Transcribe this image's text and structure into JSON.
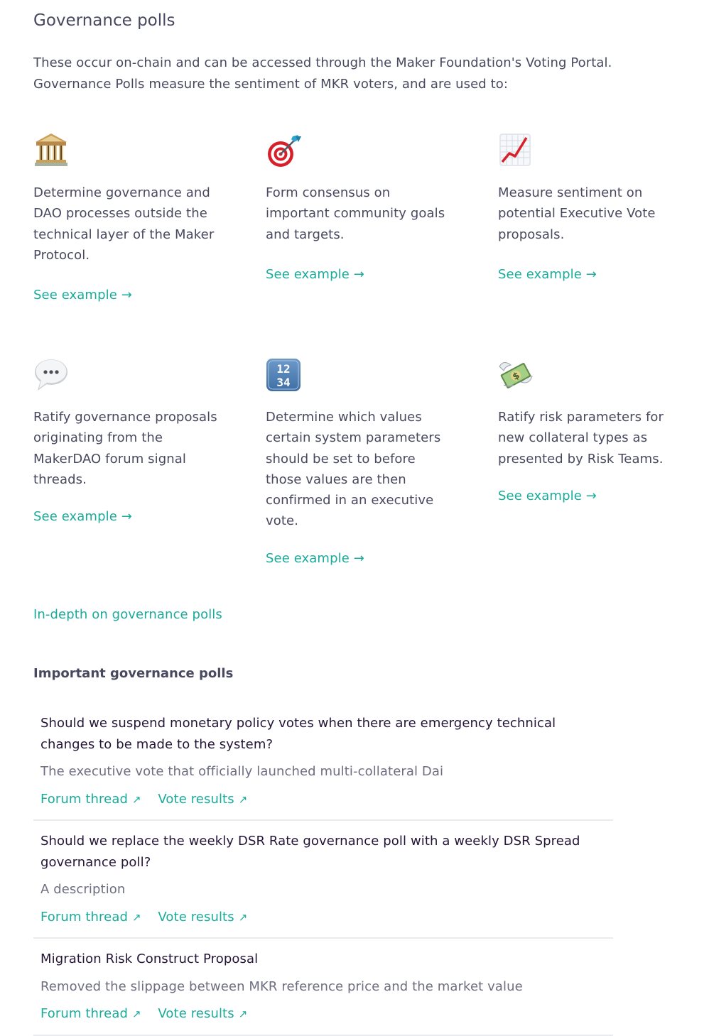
{
  "section": {
    "title": "Governance polls",
    "intro_line1": "These occur on-chain and can be accessed through the Maker Foundation's Voting Portal.",
    "intro_line2": "Governance Polls measure the sentiment of MKR voters, and are used to:"
  },
  "cards": [
    {
      "icon": "classical-building-icon",
      "text": "Determine governance and DAO processes outside the technical layer of the Maker Protocol.",
      "link": "See example",
      "link_arrow": "→"
    },
    {
      "icon": "direct-hit-target-icon",
      "text": "Form consensus on important community goals and targets.",
      "link": "See example",
      "link_arrow": "→"
    },
    {
      "icon": "chart-increasing-icon",
      "text": "Measure sentiment on potential Executive Vote proposals.",
      "link": "See example",
      "link_arrow": "→"
    },
    {
      "icon": "speech-balloon-icon",
      "text": "Ratify governance proposals originating from the MakerDAO forum signal threads.",
      "link": "See example",
      "link_arrow": "→"
    },
    {
      "icon": "input-numbers-icon",
      "icon_text_top": "12",
      "icon_text_bottom": "34",
      "text": "Determine which values certain system parameters should be set to before those values are then confirmed in an executive vote.",
      "link": "See example",
      "link_arrow": "→"
    },
    {
      "icon": "money-with-wings-icon",
      "icon_text": "$",
      "text": "Ratify risk parameters for new collateral types as presented by Risk Teams.",
      "link": "See example",
      "link_arrow": "→"
    }
  ],
  "indepth_link": "In-depth on governance polls",
  "important": {
    "heading": "Important governance polls",
    "polls": [
      {
        "title": "Should we suspend monetary policy votes when there are emergency technical changes to be made to the system?",
        "description": "The executive vote that officially launched multi-collateral Dai",
        "forum_label": "Forum thread",
        "results_label": "Vote results",
        "arrow": "↗"
      },
      {
        "title": "Should we replace the weekly DSR Rate governance poll with a weekly DSR Spread governance poll?",
        "description": "A description",
        "forum_label": "Forum thread",
        "results_label": "Vote results",
        "arrow": "↗"
      },
      {
        "title": "Migration Risk Construct Proposal",
        "description": "Removed the slippage between MKR reference price and the market value",
        "forum_label": "Forum thread",
        "results_label": "Vote results",
        "arrow": "↗"
      }
    ]
  },
  "colors": {
    "text": "#48495f",
    "heading_dark": "#231536",
    "muted": "#6d6e80",
    "link": "#1aab9b",
    "divider": "#e9ebef"
  }
}
